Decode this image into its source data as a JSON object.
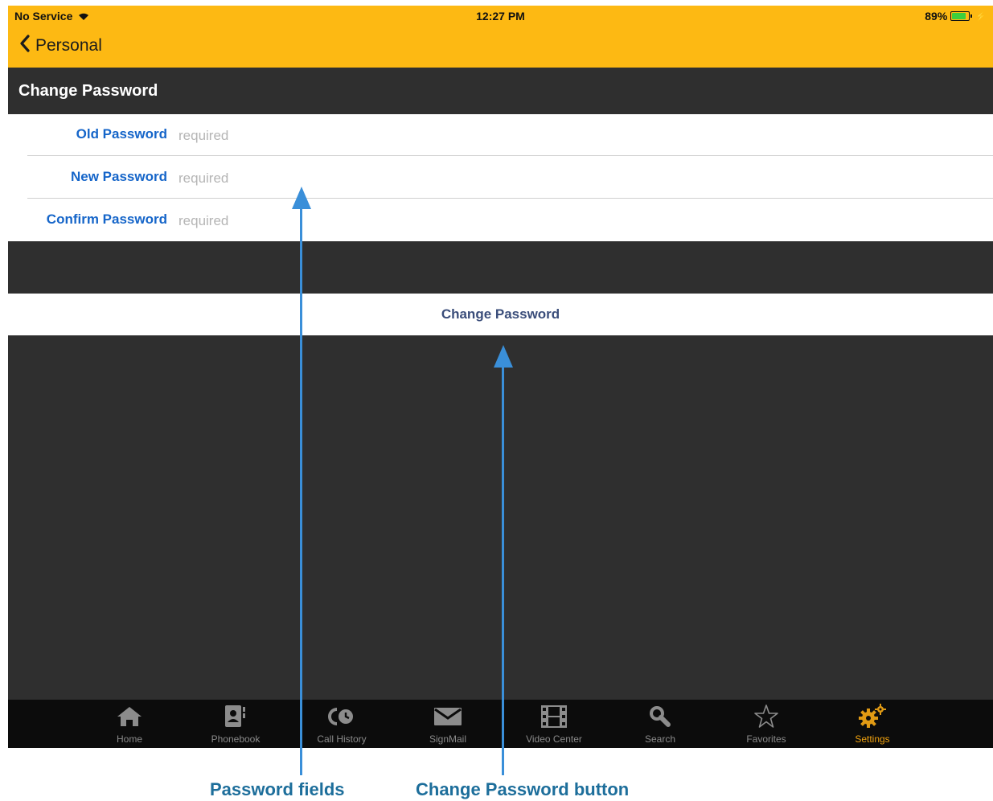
{
  "status_bar": {
    "carrier": "No Service",
    "time": "12:27 PM",
    "battery": "89%"
  },
  "nav": {
    "back_label": "Personal"
  },
  "section": {
    "title": "Change Password"
  },
  "fields": [
    {
      "label": "Old Password",
      "placeholder": "required"
    },
    {
      "label": "New Password",
      "placeholder": "required"
    },
    {
      "label": "Confirm Password",
      "placeholder": "required"
    }
  ],
  "action": {
    "label": "Change Password"
  },
  "tabs": [
    {
      "label": "Home",
      "icon": "home-icon"
    },
    {
      "label": "Phonebook",
      "icon": "phonebook-icon"
    },
    {
      "label": "Call History",
      "icon": "call-history-icon"
    },
    {
      "label": "SignMail",
      "icon": "envelope-icon"
    },
    {
      "label": "Video Center",
      "icon": "film-icon"
    },
    {
      "label": "Search",
      "icon": "search-icon"
    },
    {
      "label": "Favorites",
      "icon": "star-icon"
    },
    {
      "label": "Settings",
      "icon": "gear-icon",
      "active": true
    }
  ],
  "callouts": {
    "fields": "Password fields",
    "button": "Change Password button"
  },
  "colors": {
    "accent": "#fdb913",
    "label_blue": "#1565c9",
    "callout": "#1d6e9b",
    "arrow": "#3a8fd9",
    "active_tab": "#f0a20f"
  }
}
